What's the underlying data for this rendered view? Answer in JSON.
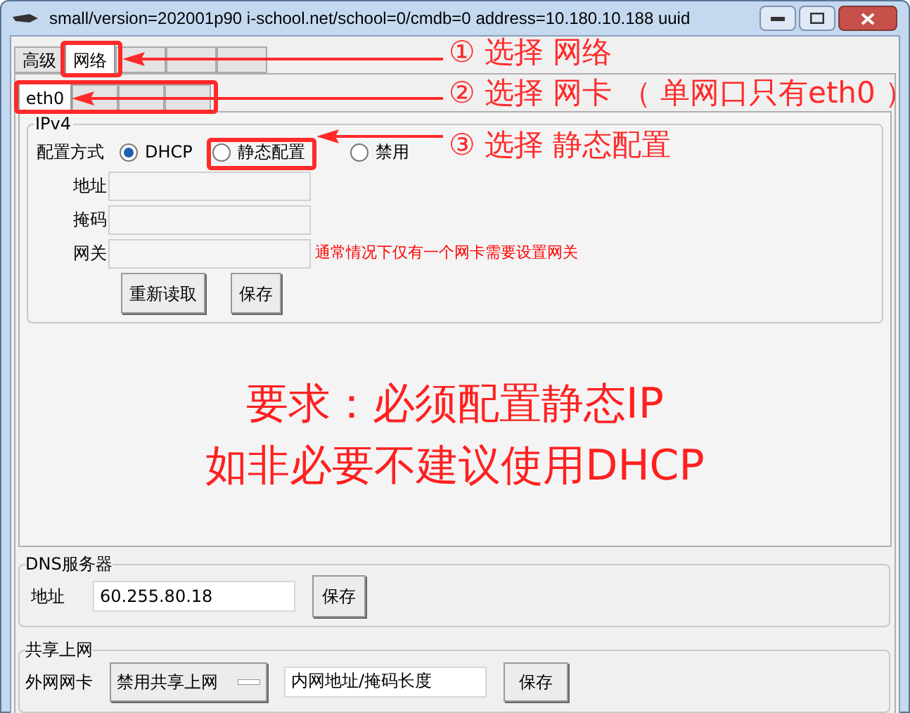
{
  "window": {
    "title": "small/version=202001p90 i-school.net/school=0/cmdb=0 address=10.180.10.188 uuid"
  },
  "tabs": [
    {
      "label": "高级",
      "selected": false
    },
    {
      "label": "网络",
      "selected": true
    },
    {
      "selected": false
    },
    {
      "selected": false
    },
    {
      "selected": false
    }
  ],
  "nic_tabs": [
    {
      "label": "eth0",
      "selected": true
    },
    {
      "selected": false
    },
    {
      "selected": false
    },
    {
      "selected": false
    }
  ],
  "ipv4": {
    "title": "IPv4",
    "mode_label": "配置方式",
    "modes": [
      {
        "label": "DHCP",
        "selected": true
      },
      {
        "label": "静态配置",
        "selected": false
      },
      {
        "label": "禁用",
        "selected": false
      }
    ],
    "fields": [
      {
        "label": "地址"
      },
      {
        "label": "掩码"
      },
      {
        "label": "网关",
        "note": "通常情况下仅有一个网卡需要设置网关"
      }
    ],
    "buttons": [
      "重新读取",
      "保存"
    ]
  },
  "notice": [
    "要求：必须配置静态IP",
    "如非必要不建议使用DHCP"
  ],
  "dns": {
    "title": "DNS服务器",
    "label": "地址",
    "value": "60.255.80.18",
    "button": "保存"
  },
  "sharing": {
    "title": "共享上网",
    "label": "外网网卡",
    "dropdown": "禁用共享上网",
    "value": "内网地址/掩码长度",
    "button": "保存"
  },
  "annotations": [
    {
      "text": "① 选择 网络"
    },
    {
      "text": "② 选择 网卡 （ 单网口只有eth0 ）"
    },
    {
      "text": "③ 选择 静态配置"
    }
  ]
}
